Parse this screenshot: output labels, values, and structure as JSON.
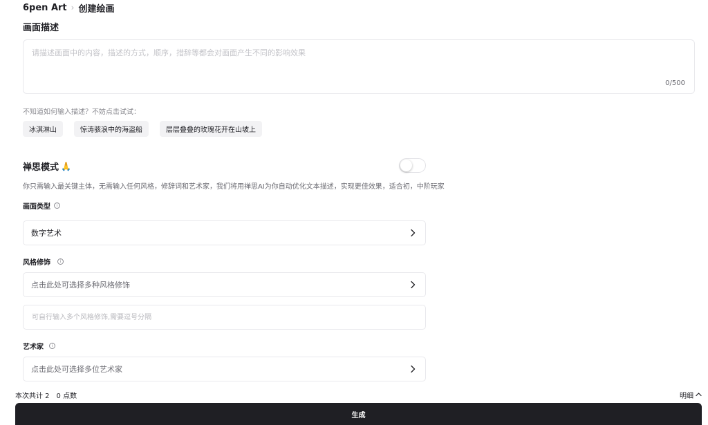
{
  "breadcrumb": {
    "root": "6pen Art",
    "current": "创建绘画"
  },
  "description": {
    "title": "画面描述",
    "placeholder": "请描述画面中的内容，描述的方式，顺序，措辞等都会对画面产生不同的影响效果",
    "value": "",
    "counter": "0/500"
  },
  "hint": "不知道如何输入描述？不妨点击试试：",
  "examples": [
    "冰淇淋山",
    "惊涛骇浪中的海盗船",
    "层层叠叠的玫瑰花开在山坡上"
  ],
  "zen_mode": {
    "title": "禅思模式",
    "emoji": "🙏",
    "enabled": false,
    "description": "你只需输入最关键主体，无需输入任何风格，修辞词和艺术家，我们将用禅思AI为你自动优化文本描述，实现更佳效果，适合初，中阶玩家"
  },
  "picture_type": {
    "label": "画面类型",
    "value": "数字艺术"
  },
  "style": {
    "label": "风格修饰",
    "select_placeholder": "点击此处可选择多种风格修饰",
    "input_placeholder": "可自行输入多个风格修饰,需要逗号分隔"
  },
  "artist": {
    "label": "艺术家",
    "select_placeholder": "点击此处可选择多位艺术家"
  },
  "footer": {
    "total": "本次共计 2",
    "points": "0 点数",
    "details_label": "明细",
    "generate_label": "生成"
  },
  "icons": {
    "info": "info-icon",
    "chevron": "chevron-right-icon",
    "caret_up": "chevron-up-icon"
  },
  "colors": {
    "primary": "#1f1f24",
    "border": "#e8e8ec",
    "chip_bg": "#f2f2f4"
  }
}
